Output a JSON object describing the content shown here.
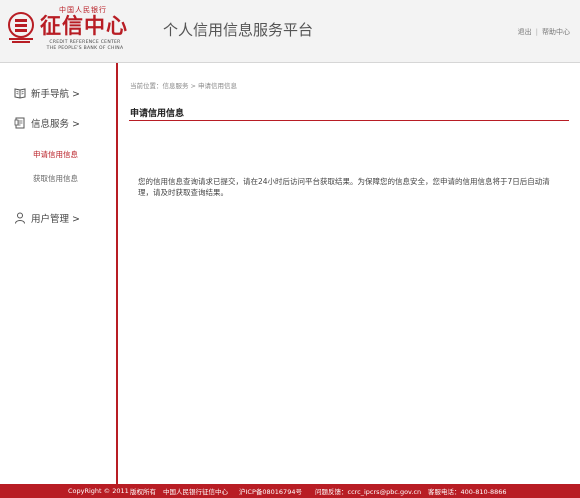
{
  "header": {
    "logo_org": "中国人民银行",
    "logo_name": "征信中心",
    "logo_en_line1": "CREDIT REFERENCE CENTER",
    "logo_en_line2": "THE PEOPLE'S BANK OF CHINA",
    "platform_title": "个人信用信息服务平台",
    "links": {
      "logout": "退出",
      "separator": "|",
      "help": "帮助中心"
    }
  },
  "sidebar": {
    "items": [
      {
        "label": "新手导航 >",
        "icon": "book-icon"
      },
      {
        "label": "信息服务 >",
        "icon": "document-icon"
      },
      {
        "label": "用户管理 >",
        "icon": "user-icon"
      }
    ],
    "sub_items": [
      {
        "label": "申请信用信息",
        "active": true
      },
      {
        "label": "获取信用信息",
        "active": false
      }
    ]
  },
  "main": {
    "breadcrumb": {
      "prefix": "当前位置：",
      "level1": "信息服务",
      "separator": ">",
      "level2": "申请信用信息"
    },
    "section_title": "申请信用信息",
    "message": "您的信用信息查询请求已提交，请在24小时后访问平台获取结果。为保障您的信息安全，您申请的信用信息将于7日后自动清理，请及时获取查询结果。"
  },
  "footer": {
    "copyright": "CopyRight © 2011",
    "rights": "版权所有",
    "org": "中国人民银行征信中心",
    "icp": "沪ICP备08016794号",
    "feedback": "问题反馈：ccrc_ipcrs@pbc.gov.cn",
    "phone": "客服电话：400-810-8866"
  },
  "colors": {
    "brand_red": "#b81d24",
    "header_bg": "#f3f3f3"
  }
}
